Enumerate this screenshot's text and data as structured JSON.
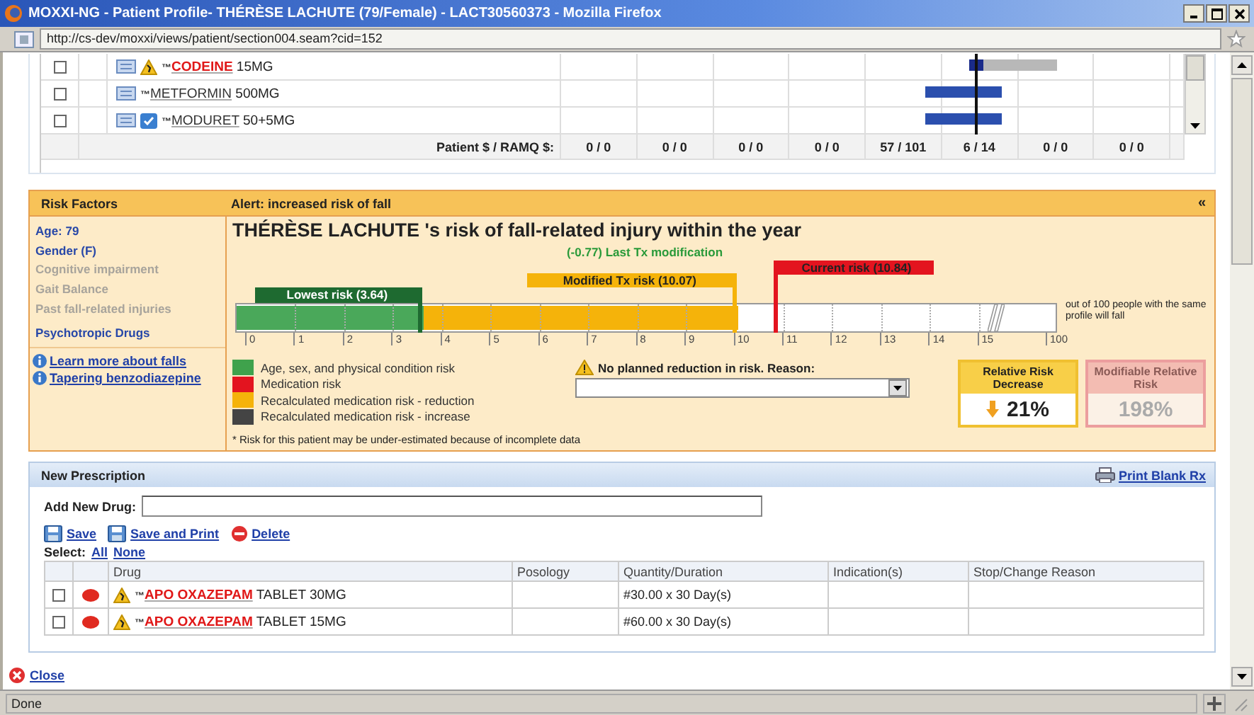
{
  "window": {
    "title": "MOXXI-NG - Patient Profile- THÉRÈSE LACHUTE (79/Female) - LACT30560373 - Mozilla Firefox"
  },
  "address_bar": {
    "url": "http://cs-dev/moxxi/views/patient/section004.seam?cid=152"
  },
  "medication_table": {
    "rows": [
      {
        "kind": "warning",
        "checked": false,
        "tm": "™",
        "name": "CODEINE",
        "name_alert": true,
        "dose": "15MG"
      },
      {
        "kind": "plain",
        "checked": false,
        "tm": "™",
        "name": "METFORMIN",
        "name_alert": false,
        "dose": "500MG"
      },
      {
        "kind": "check",
        "checked": false,
        "tm": "™",
        "name": "MODURET",
        "name_alert": false,
        "dose": "50+5MG"
      }
    ],
    "footer_label": "Patient $ / RAMQ $:",
    "footer_values": [
      "0 / 0",
      "0 / 0",
      "0 / 0",
      "0 / 0",
      "57 / 101",
      "6 / 14",
      "0 / 0",
      "0 / 0"
    ]
  },
  "risk_panel": {
    "title": "Risk Factors",
    "alert": "Alert: increased risk of fall",
    "collapse_glyph": "«",
    "factors": [
      {
        "label": "Age: 79",
        "active": true
      },
      {
        "label": "Gender (F)",
        "active": true
      },
      {
        "label": "Cognitive impairment",
        "active": false
      },
      {
        "label": "Gait Balance",
        "active": false
      },
      {
        "label": "Past fall-related injuries",
        "active": false
      },
      {
        "label": "Psychotropic Drugs",
        "active": true
      }
    ],
    "links": [
      "Learn more about falls",
      "Tapering benzodiazepine"
    ],
    "heading": "THÉRÈSE LACHUTE 's risk of fall-related injury within the year",
    "modification": "(-0.77) Last Tx modification",
    "markers": [
      {
        "kind": "lowest",
        "label": "Lowest risk (3.64)"
      },
      {
        "kind": "modified",
        "label": "Modified Tx risk (10.07)"
      },
      {
        "kind": "current",
        "label": "Current risk (10.84)"
      }
    ],
    "ticks": [
      "0",
      "1",
      "2",
      "3",
      "4",
      "5",
      "6",
      "7",
      "8",
      "9",
      "10",
      "11",
      "12",
      "13",
      "14",
      "15",
      "100"
    ],
    "scale_note": "out of 100 people with the same profile will fall",
    "legend": [
      {
        "label": "Age, sex, and physical condition risk",
        "color": "#3fa24c"
      },
      {
        "label": "Medication risk",
        "color": "#e3141f"
      },
      {
        "label": "Recalculated medication risk - reduction",
        "color": "#f5b30a"
      },
      {
        "label": "Recalculated medication risk - increase",
        "color": "#444444"
      }
    ],
    "reason_label": "No planned reduction in risk. Reason:",
    "footnote": "* Risk for this patient may be under-estimated because of incomplete data",
    "risk_boxes": [
      {
        "title": "Relative Risk Decrease",
        "value": "21%",
        "arrow": true,
        "disabled": false
      },
      {
        "title": "Modifiable Relative Risk",
        "value": "198%",
        "arrow": false,
        "disabled": true
      }
    ]
  },
  "prescription": {
    "title": "New Prescription",
    "print_link": "Print Blank Rx",
    "add_label": "Add New Drug:",
    "actions": [
      {
        "kind": "save",
        "label": "Save"
      },
      {
        "kind": "save",
        "label": "Save and Print"
      },
      {
        "kind": "delete",
        "label": "Delete"
      }
    ],
    "select_label": "Select:",
    "select_links": [
      "All",
      "None"
    ],
    "columns": [
      "Drug",
      "Posology",
      "Quantity/Duration",
      "Indication(s)",
      "Stop/Change Reason"
    ],
    "rows": [
      {
        "checked": false,
        "tm": "™",
        "name": "APO OXAZEPAM",
        "form": "TABLET 30MG",
        "quantity": "#30.00 x 30 Day(s)"
      },
      {
        "checked": false,
        "tm": "™",
        "name": "APO OXAZEPAM",
        "form": "TABLET 15MG",
        "quantity": "#60.00 x 30 Day(s)"
      }
    ]
  },
  "close_link": "Close",
  "status_bar": {
    "text": "Done"
  }
}
